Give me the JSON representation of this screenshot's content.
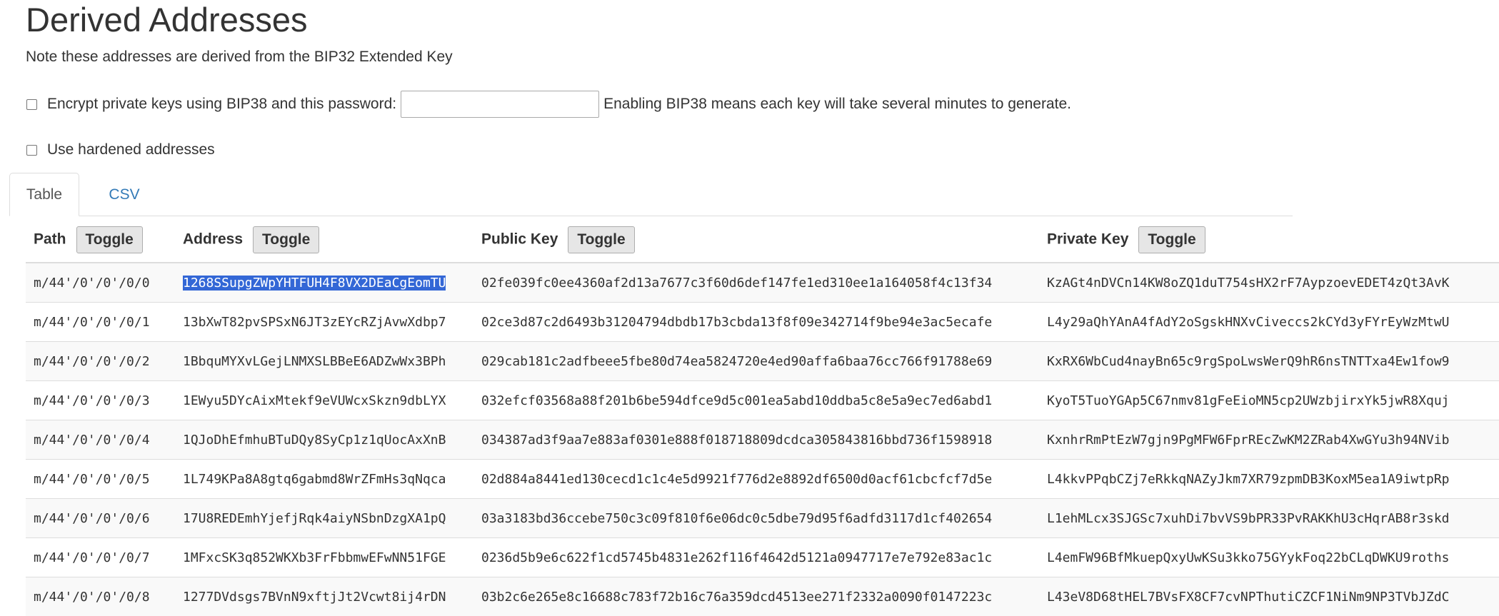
{
  "section": {
    "title": "Derived Addresses",
    "note": "Note these addresses are derived from the BIP32 Extended Key",
    "bip38_label": "Encrypt private keys using BIP38 and this password:",
    "bip38_password": "",
    "bip38_hint": "Enabling BIP38 means each key will take several minutes to generate.",
    "hardened_label": "Use hardened addresses"
  },
  "tabs": [
    {
      "label": "Table",
      "active": true
    },
    {
      "label": "CSV",
      "active": false
    }
  ],
  "table": {
    "headers": {
      "path": "Path",
      "address": "Address",
      "public_key": "Public Key",
      "private_key": "Private Key"
    },
    "toggle_label": "Toggle",
    "rows": [
      [
        "m/44'/0'/0'/0/0",
        "1268SSupgZWpYHTFUH4F8VX2DEaCgEomTU",
        "02fe039fc0ee4360af2d13a7677c3f60d6def147fe1ed310ee1a164058f4c13f34",
        "KzAGt4nDVCn14KW8oZQ1duT754sHX2rF7AypzoevEDET4zQt3AvK"
      ],
      [
        "m/44'/0'/0'/0/1",
        "13bXwT82pvSPSxN6JT3zEYcRZjAvwXdbp7",
        "02ce3d87c2d6493b31204794dbdb17b3cbda13f8f09e342714f9be94e3ac5ecafe",
        "L4y29aQhYAnA4fAdY2oSgskHNXvCiveccs2kCYd3yFYrEyWzMtwU"
      ],
      [
        "m/44'/0'/0'/0/2",
        "1BbquMYXvLGejLNMXSLBBeE6ADZwWx3BPh",
        "029cab181c2adfbeee5fbe80d74ea5824720e4ed90affa6baa76cc766f91788e69",
        "KxRX6WbCud4nayBn65c9rgSpoLwsWerQ9hR6nsTNTTxa4Ew1fow9"
      ],
      [
        "m/44'/0'/0'/0/3",
        "1EWyu5DYcAixMtekf9eVUWcxSkzn9dbLYX",
        "032efcf03568a88f201b6be594dfce9d5c001ea5abd10ddba5c8e5a9ec7ed6abd1",
        "KyoT5TuoYGAp5C67nmv81gFeEioMN5cp2UWzbjirxYk5jwR8Xquj"
      ],
      [
        "m/44'/0'/0'/0/4",
        "1QJoDhEfmhuBTuDQy8SyCp1z1qUocAxXnB",
        "034387ad3f9aa7e883af0301e888f018718809dcdca305843816bbd736f1598918",
        "KxnhrRmPtEzW7gjn9PgMFW6FprREcZwKM2ZRab4XwGYu3h94NVib"
      ],
      [
        "m/44'/0'/0'/0/5",
        "1L749KPa8A8gtq6gabmd8WrZFmHs3qNqca",
        "02d884a8441ed130cecd1c1c4e5d9921f776d2e8892df6500d0acf61cbcfcf7d5e",
        "L4kkvPPqbCZj7eRkkqNAZyJkm7XR79zpmDB3KoxM5ea1A9iwtpRp"
      ],
      [
        "m/44'/0'/0'/0/6",
        "17U8REDEmhYjefjRqk4aiyNSbnDzgXA1pQ",
        "03a3183bd36ccebe750c3c09f810f6e06dc0c5dbe79d95f6adfd3117d1cf402654",
        "L1ehMLcx3SJGSc7xuhDi7bvVS9bPR33PvRAKKhU3cHqrAB8r3skd"
      ],
      [
        "m/44'/0'/0'/0/7",
        "1MFxcSK3q852WKXb3FrFbbmwEFwNN51FGE",
        "0236d5b9e6c622f1cd5745b4831e262f116f4642d5121a0947717e7e792e83ac1c",
        "L4emFW96BfMkuepQxyUwKSu3kko75GYykFoq22bCLqDWKU9roths"
      ],
      [
        "m/44'/0'/0'/0/8",
        "1277DVdsgs7BVnN9xftjJt2Vcwt8ij4rDN",
        "03b2c6e265e8c16688c783f72b16c76a359dcd4513ee271f2332a0090f0147223c",
        "L43eV8D68tHEL7BVsFX8CF7cvNPThutiCZCF1NiNm9NP3TVbJZdC"
      ]
    ],
    "selected_text": "1268SSupgZWpYHTFUH4F8VX2DEaCgEomTU",
    "selection_color": "#3367d6"
  }
}
